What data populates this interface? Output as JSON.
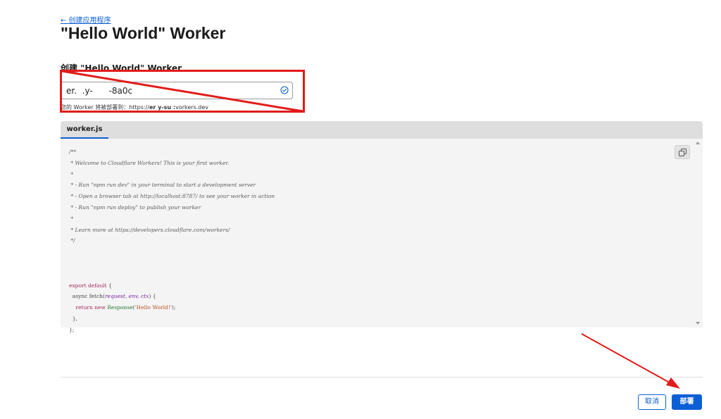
{
  "header": {
    "back_link": "← 创建应用程序",
    "title": "\"Hello World\" Worker"
  },
  "form": {
    "section_label": "创建 \"Hello World\" Worker",
    "worker_name_value": "er.  .y-      -8a0c",
    "preview_prefix": "您的 Worker 将被部署到：https://",
    "preview_host": "er    y-su   :",
    "preview_suffix": "vorkers.dev"
  },
  "editor": {
    "tab": "worker.js",
    "code": {
      "comment": "/**\n * Welcome to Cloudflare Workers! This is your first worker.\n *\n * - Run \"npm run dev\" in your terminal to start a development server\n * - Open a browser tab at http://localhost:8787/ to see your worker in action\n * - Run \"npm run deploy\" to publish your worker\n *\n * Learn more at https://developers.cloudflare.com/workers/\n */",
      "export_default": "export default",
      "open_brace": " {",
      "async_fetch": "  async fetch(",
      "params": "request, env, ctx",
      "fetch_open": ") {",
      "return_new": "    return new ",
      "response": "Response",
      "paren_open": "(",
      "hello": "'Hello World!'",
      "paren_close": ");",
      "close_fn": "  },",
      "close_obj": "};"
    }
  },
  "footer": {
    "cancel_label": "取消",
    "deploy_label": "部署"
  },
  "colors": {
    "accent": "#0b5fd6",
    "annotation": "#e31a1a"
  },
  "icons": [
    "arrow-left-icon",
    "check-circle-icon",
    "copy-icon",
    "scroll-up-icon",
    "scroll-down-icon"
  ]
}
